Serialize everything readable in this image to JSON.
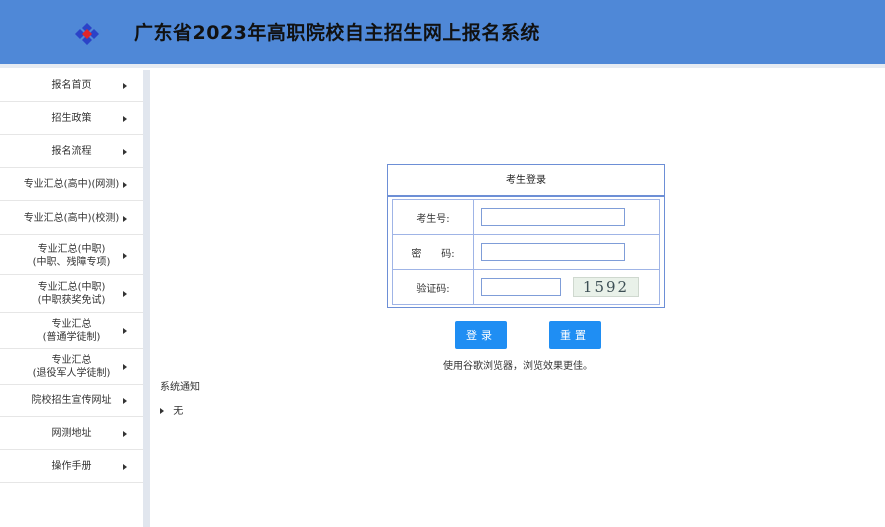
{
  "header": {
    "title": "广东省2023年高职院校自主招生网上报名系统",
    "bg_color": "#4f88d7",
    "logo_icon": "diamond-cluster-logo"
  },
  "sidebar": {
    "items": [
      {
        "label": "报名首页"
      },
      {
        "label": "招生政策"
      },
      {
        "label": "报名流程"
      },
      {
        "label": "专业汇总(高中)(网测)"
      },
      {
        "label": "专业汇总(高中)(校测)"
      },
      {
        "label": "专业汇总(中职)\n(中职、残障专项)"
      },
      {
        "label": "专业汇总(中职)\n(中职获奖免试)"
      },
      {
        "label": "专业汇总\n(普通学徒制)"
      },
      {
        "label": "专业汇总\n(退役军人学徒制)"
      },
      {
        "label": "院校招生宣传网址"
      },
      {
        "label": "网测地址"
      },
      {
        "label": "操作手册"
      }
    ]
  },
  "notice": {
    "title": "系统通知",
    "items": [
      "无"
    ]
  },
  "login": {
    "title": "考生登录",
    "fields": [
      {
        "label": "考生号:",
        "value": ""
      },
      {
        "label": "密　　码:",
        "value": ""
      },
      {
        "label": "验证码:",
        "value": ""
      }
    ],
    "captcha": "1592",
    "login_label": "登录",
    "reset_label": "重置",
    "hint": "使用谷歌浏览器，浏览效果更佳。",
    "button_color": "#1f8ef3"
  }
}
